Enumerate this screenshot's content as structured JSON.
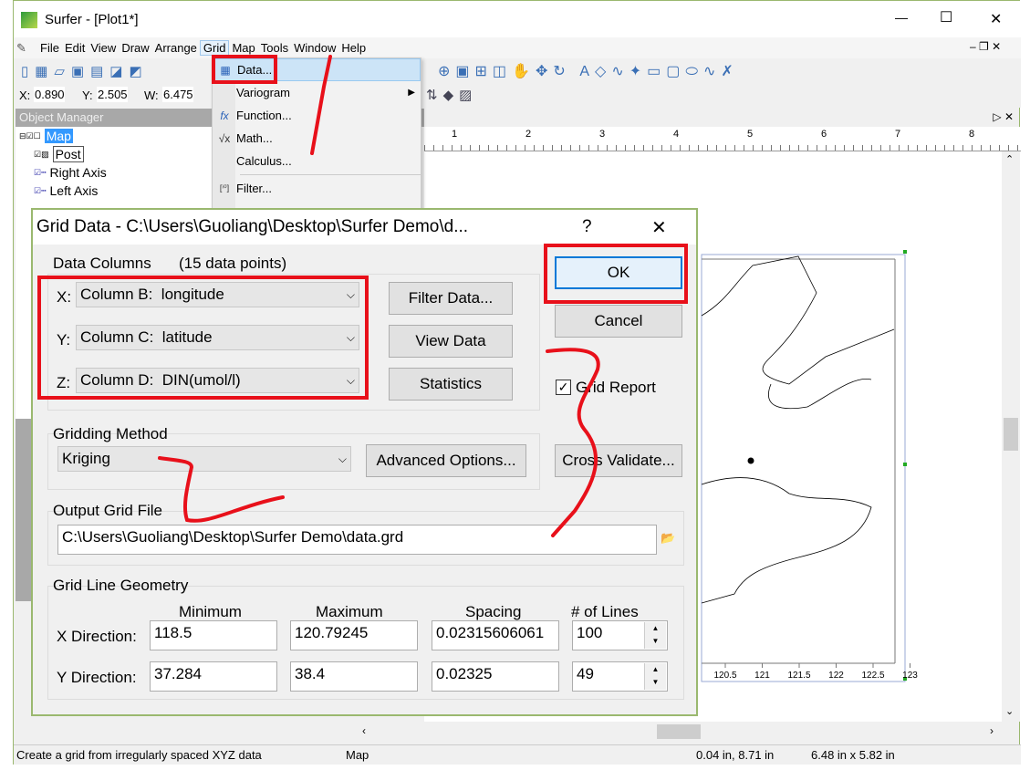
{
  "window": {
    "title": "Surfer - [Plot1*]",
    "minimize": "—",
    "maximize": "☐",
    "close": "✕"
  },
  "menubar": [
    "File",
    "Edit",
    "View",
    "Draw",
    "Arrange",
    "Grid",
    "Map",
    "Tools",
    "Window",
    "Help"
  ],
  "toolbar2": {
    "x_label": "X:",
    "x": "0.890",
    "y_label": "Y:",
    "y": "2.505",
    "w_label": "W:",
    "w": "6.475"
  },
  "object_manager": {
    "title": "Object Manager",
    "items": [
      "Map",
      "Post",
      "Right Axis",
      "Left Axis"
    ],
    "selected": "Map"
  },
  "grid_menu": {
    "items": [
      {
        "label": "Data...",
        "icon": "grid-icon"
      },
      {
        "label": "Variogram",
        "icon": "",
        "submenu": true
      },
      {
        "label": "Function...",
        "icon": "fx-icon"
      },
      {
        "label": "Math...",
        "icon": "sqrt-icon"
      },
      {
        "label": "Calculus...",
        "icon": ""
      },
      {
        "label": "Filter...",
        "icon": "matrix-icon"
      }
    ]
  },
  "ruler": [
    "1",
    "2",
    "3",
    "4",
    "5",
    "6",
    "7",
    "8"
  ],
  "map_axis": [
    "120.5",
    "121",
    "121.5",
    "122",
    "122.5",
    "123"
  ],
  "dialog": {
    "title": "Grid Data - C:\\Users\\Guoliang\\Desktop\\Surfer Demo\\d...",
    "help": "?",
    "close": "✕",
    "data_columns_label": "Data Columns",
    "data_points": "(15 data points)",
    "x_label": "X:",
    "x_value": "Column B:  longitude",
    "y_label": "Y:",
    "y_value": "Column C:  latitude",
    "z_label": "Z:",
    "z_value": "Column D:  DIN(umol/l)",
    "filter_data": "Filter Data...",
    "view_data": "View Data",
    "statistics": "Statistics",
    "ok": "OK",
    "cancel": "Cancel",
    "grid_report_label": "Grid Report",
    "grid_report_checked": true,
    "gridding_method_label": "Gridding Method",
    "gridding_method": "Kriging",
    "advanced_options": "Advanced Options...",
    "cross_validate": "Cross Validate...",
    "output_grid_label": "Output Grid File",
    "output_grid_path": "C:\\Users\\Guoliang\\Desktop\\Surfer Demo\\data.grd",
    "geometry_label": "Grid Line Geometry",
    "columns": [
      "Minimum",
      "Maximum",
      "Spacing",
      "# of Lines"
    ],
    "rows": [
      {
        "label": "X Direction:",
        "min": "118.5",
        "max": "120.79245",
        "spacing": "0.02315606061",
        "lines": "100"
      },
      {
        "label": "Y Direction:",
        "min": "37.284",
        "max": "38.4",
        "spacing": "0.02325",
        "lines": "49"
      }
    ]
  },
  "status": {
    "hint": "Create a grid from irregularly spaced XYZ data",
    "object": "Map",
    "position": "0.04 in, 8.71 in",
    "size": "6.48 in x 5.82 in"
  },
  "colors": {
    "annotation": "#e8101a",
    "selection": "#3399ff",
    "menu_highlight": "#cce4f7"
  }
}
